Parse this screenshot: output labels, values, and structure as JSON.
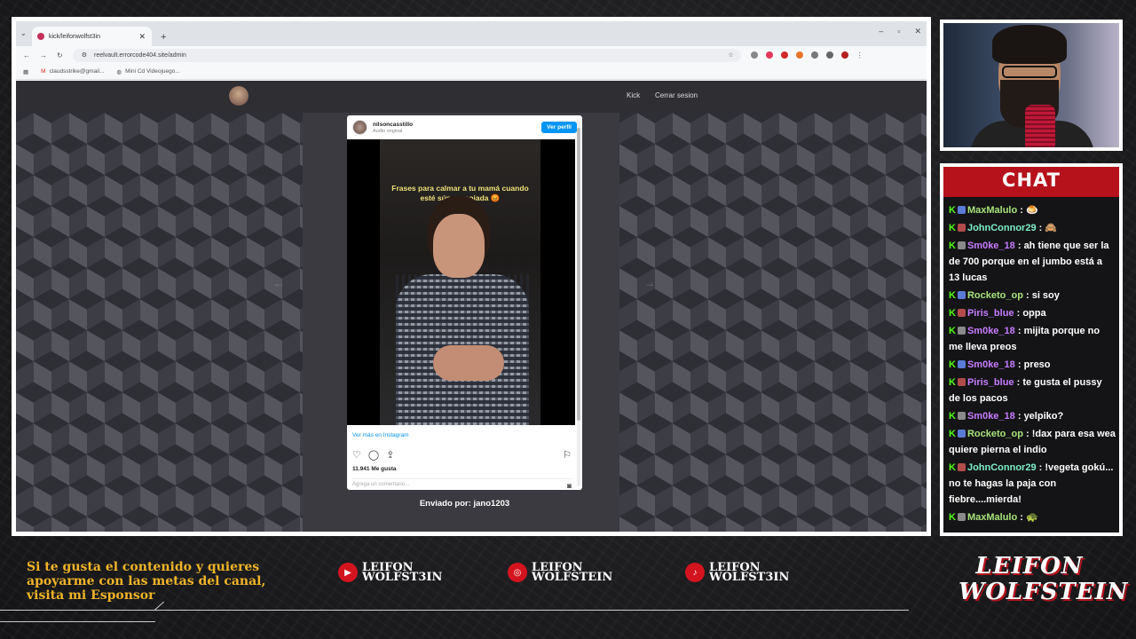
{
  "browser": {
    "tab_title": "kick/leifonwolfst3in",
    "url": "reelvault.errorcode404.site/admin",
    "bookmarks": [
      "claudsstrike@gmail...",
      "Mini Cd Videojuego..."
    ]
  },
  "site": {
    "nav_kick": "Kick",
    "nav_logout": "Cerrar sesion",
    "sent_by": "Enviado por: jano1203"
  },
  "instagram": {
    "username": "nilsoncasstillo",
    "audio": "Audio original",
    "view_profile": "Ver perfil",
    "overlay_text": "Frases para calmar a tu mamá cuando esté súper enojada 😡",
    "view_more": "Ver más en Instagram",
    "likes": "11.941 Me gusta",
    "comment_placeholder": "Agrega un comentario..."
  },
  "chat": {
    "title": "CHAT",
    "messages": [
      {
        "user": "MaxMalulo",
        "text": ": 🍮",
        "color": "#a7e27a"
      },
      {
        "user": "JohnConnor29",
        "text": ": 🙈",
        "color": "#7ef0c8"
      },
      {
        "user": "Sm0ke_18",
        "text": ": ah tiene que ser la de 700 porque en el jumbo está a 13 lucas",
        "color": "#c77cff"
      },
      {
        "user": "Rocketo_op",
        "text": ": si soy",
        "color": "#a7e27a"
      },
      {
        "user": "Piris_blue",
        "text": ": oppa",
        "color": "#c77cff"
      },
      {
        "user": "Sm0ke_18",
        "text": ": mijita porque no me lleva preos",
        "color": "#c77cff"
      },
      {
        "user": "Sm0ke_18",
        "text": ": preso",
        "color": "#c77cff"
      },
      {
        "user": "Piris_blue",
        "text": ": te gusta el pussy de los pacos",
        "color": "#c77cff"
      },
      {
        "user": "Sm0ke_18",
        "text": ": yelpiko?",
        "color": "#c77cff"
      },
      {
        "user": "Rocketo_op",
        "text": ": !dax para esa wea quiere pierna el indio",
        "color": "#a7e27a"
      },
      {
        "user": "JohnConnor29",
        "text": ": !vegeta gokú... no te hagas la paja con fiebre....mierda!",
        "color": "#7ef0c8"
      },
      {
        "user": "MaxMalulo",
        "text": ": 🐢",
        "color": "#a7e27a"
      }
    ]
  },
  "footer": {
    "sponsor_lines": [
      "Si te gusta el contenido y quieres",
      "apoyarme con las metas del canal,",
      "visita mi Esponsor"
    ],
    "youtube_name": [
      "LEIFON",
      "WOLFST3IN"
    ],
    "instagram_name": [
      "LEIFON",
      "WOLFSTEIN"
    ],
    "tiktok_name": [
      "LEIFON",
      "WOLFST3IN"
    ],
    "brand": [
      "LEIFON",
      "WOLFSTEIN"
    ]
  }
}
